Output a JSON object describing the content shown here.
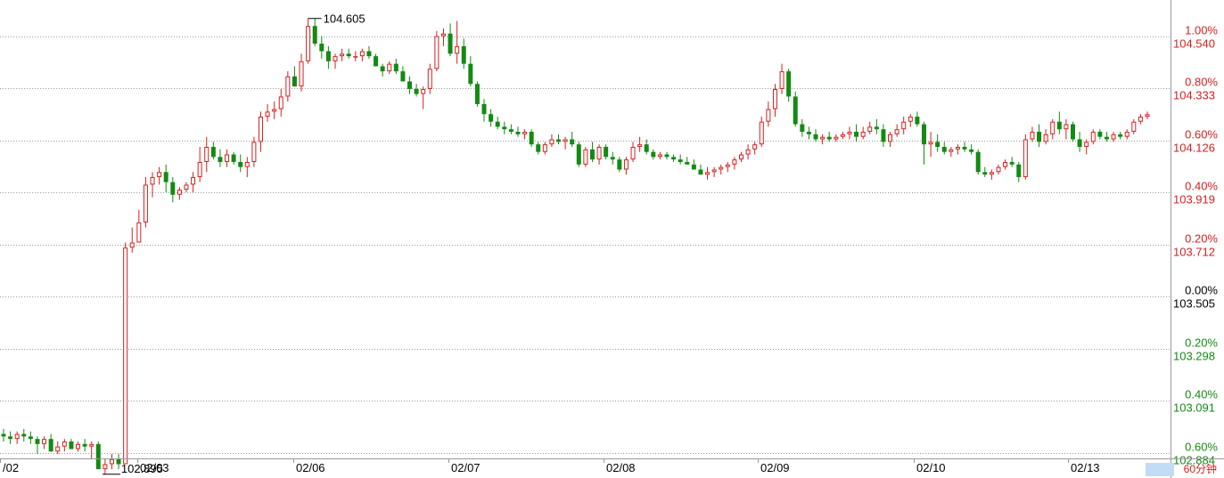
{
  "chart_data": {
    "type": "candlestick",
    "base_price": 103.505,
    "ylim": [
      102.884,
      104.655
    ],
    "grid": "dotted horizontal",
    "price_ticks": [
      "104.540",
      "104.333",
      "104.126",
      "103.919",
      "103.712",
      "103.505",
      "103.298",
      "103.091",
      "102.884"
    ],
    "pct_ticks": [
      "1.00%",
      "0.80%",
      "0.60%",
      "0.40%",
      "0.20%",
      "0.00%",
      "0.20%",
      "0.40%",
      "0.60%"
    ],
    "date_labels": [
      "/02",
      "02/03",
      "02/06",
      "02/07",
      "02/08",
      "02/09",
      "02/10",
      "02/13"
    ],
    "annotations": {
      "high_label": "104.605",
      "low_label": "102.895"
    },
    "candles": [
      [
        102.96,
        102.98,
        102.93,
        102.95
      ],
      [
        102.95,
        102.97,
        102.92,
        102.94
      ],
      [
        102.94,
        102.97,
        102.92,
        102.96
      ],
      [
        102.96,
        102.98,
        102.93,
        102.95
      ],
      [
        102.95,
        102.97,
        102.92,
        102.94
      ],
      [
        102.94,
        102.95,
        102.88,
        102.92
      ],
      [
        102.92,
        102.95,
        102.9,
        102.94
      ],
      [
        102.94,
        102.96,
        102.89,
        102.89
      ],
      [
        102.89,
        102.93,
        102.88,
        102.91
      ],
      [
        102.91,
        102.94,
        102.89,
        102.93
      ],
      [
        102.93,
        102.94,
        102.9,
        102.9
      ],
      [
        102.9,
        102.93,
        102.89,
        102.92
      ],
      [
        102.92,
        102.94,
        102.89,
        102.91
      ],
      [
        102.91,
        102.93,
        102.86,
        102.92
      ],
      [
        102.92,
        102.93,
        102.84,
        102.82
      ],
      [
        102.82,
        102.86,
        102.8,
        102.84
      ],
      [
        102.84,
        102.88,
        102.82,
        102.86
      ],
      [
        102.86,
        102.88,
        102.82,
        102.84
      ],
      [
        102.84,
        103.72,
        102.84,
        103.7
      ],
      [
        103.7,
        103.78,
        103.68,
        103.72
      ],
      [
        103.72,
        103.85,
        103.72,
        103.8
      ],
      [
        103.8,
        103.98,
        103.78,
        103.95
      ],
      [
        103.95,
        104.0,
        103.9,
        103.98
      ],
      [
        103.98,
        104.02,
        103.95,
        104.0
      ],
      [
        104.0,
        104.03,
        103.92,
        103.96
      ],
      [
        103.96,
        103.98,
        103.88,
        103.91
      ],
      [
        103.91,
        103.94,
        103.89,
        103.93
      ],
      [
        103.93,
        103.96,
        103.92,
        103.95
      ],
      [
        103.95,
        104.0,
        103.92,
        103.98
      ],
      [
        103.98,
        104.1,
        103.96,
        104.04
      ],
      [
        104.04,
        104.14,
        104.0,
        104.1
      ],
      [
        104.1,
        104.12,
        104.05,
        104.06
      ],
      [
        104.06,
        104.09,
        104.02,
        104.04
      ],
      [
        104.04,
        104.09,
        104.02,
        104.07
      ],
      [
        104.07,
        104.08,
        104.03,
        104.04
      ],
      [
        104.04,
        104.07,
        104.0,
        104.02
      ],
      [
        104.02,
        104.06,
        103.98,
        104.04
      ],
      [
        104.04,
        104.14,
        104.02,
        104.12
      ],
      [
        104.12,
        104.24,
        104.08,
        104.22
      ],
      [
        104.22,
        104.27,
        104.2,
        104.24
      ],
      [
        104.24,
        104.28,
        104.21,
        104.25
      ],
      [
        104.25,
        104.33,
        104.22,
        104.3
      ],
      [
        104.3,
        104.4,
        104.28,
        104.38
      ],
      [
        104.38,
        104.42,
        104.34,
        104.34
      ],
      [
        104.34,
        104.47,
        104.32,
        104.44
      ],
      [
        104.44,
        104.61,
        104.43,
        104.58
      ],
      [
        104.58,
        104.61,
        104.5,
        104.51
      ],
      [
        104.51,
        104.54,
        104.45,
        104.48
      ],
      [
        104.48,
        104.5,
        104.41,
        104.44
      ],
      [
        104.44,
        104.47,
        104.41,
        104.46
      ],
      [
        104.46,
        104.49,
        104.44,
        104.47
      ],
      [
        104.47,
        104.49,
        104.45,
        104.46
      ],
      [
        104.46,
        104.48,
        104.44,
        104.46
      ],
      [
        104.46,
        104.49,
        104.44,
        104.48
      ],
      [
        104.48,
        104.5,
        104.45,
        104.46
      ],
      [
        104.46,
        104.47,
        104.42,
        104.42
      ],
      [
        104.42,
        104.43,
        104.38,
        104.4
      ],
      [
        104.4,
        104.44,
        104.39,
        104.43
      ],
      [
        104.43,
        104.45,
        104.39,
        104.4
      ],
      [
        104.4,
        104.42,
        104.36,
        104.36
      ],
      [
        104.36,
        104.38,
        104.31,
        104.33
      ],
      [
        104.33,
        104.35,
        104.3,
        104.31
      ],
      [
        104.31,
        104.34,
        104.25,
        104.33
      ],
      [
        104.33,
        104.43,
        104.31,
        104.41
      ],
      [
        104.41,
        104.56,
        104.4,
        104.54
      ],
      [
        104.54,
        104.57,
        104.5,
        104.55
      ],
      [
        104.55,
        104.59,
        104.46,
        104.47
      ],
      [
        104.47,
        104.6,
        104.43,
        104.5
      ],
      [
        104.5,
        104.53,
        104.41,
        104.43
      ],
      [
        104.43,
        104.46,
        104.34,
        104.35
      ],
      [
        104.35,
        104.36,
        104.26,
        104.27
      ],
      [
        104.27,
        104.29,
        104.2,
        104.23
      ],
      [
        104.23,
        104.25,
        104.18,
        104.2
      ],
      [
        104.2,
        104.22,
        104.17,
        104.18
      ],
      [
        104.18,
        104.2,
        104.15,
        104.17
      ],
      [
        104.17,
        104.19,
        104.15,
        104.16
      ],
      [
        104.16,
        104.18,
        104.14,
        104.15
      ],
      [
        104.15,
        104.17,
        104.13,
        104.16
      ],
      [
        104.16,
        104.17,
        104.1,
        104.11
      ],
      [
        104.11,
        104.12,
        104.07,
        104.08
      ],
      [
        104.08,
        104.12,
        104.07,
        104.11
      ],
      [
        104.11,
        104.15,
        104.1,
        104.13
      ],
      [
        104.13,
        104.15,
        104.11,
        104.12
      ],
      [
        104.12,
        104.14,
        104.09,
        104.13
      ],
      [
        104.13,
        104.16,
        104.1,
        104.11
      ],
      [
        104.11,
        104.12,
        104.02,
        104.03
      ],
      [
        104.03,
        104.1,
        104.02,
        104.09
      ],
      [
        104.09,
        104.12,
        104.04,
        104.05
      ],
      [
        104.05,
        104.11,
        104.03,
        104.1
      ],
      [
        104.1,
        104.11,
        104.05,
        104.06
      ],
      [
        104.06,
        104.08,
        104.03,
        104.05
      ],
      [
        104.05,
        104.06,
        104.0,
        104.01
      ],
      [
        104.01,
        104.06,
        103.99,
        104.05
      ],
      [
        104.05,
        104.12,
        104.04,
        104.1
      ],
      [
        104.1,
        104.14,
        104.08,
        104.11
      ],
      [
        104.11,
        104.13,
        104.07,
        104.08
      ],
      [
        104.08,
        104.09,
        104.05,
        104.06
      ],
      [
        104.06,
        104.08,
        104.05,
        104.07
      ],
      [
        104.07,
        104.08,
        104.05,
        104.06
      ],
      [
        104.06,
        104.07,
        104.04,
        104.05
      ],
      [
        104.05,
        104.07,
        104.03,
        104.04
      ],
      [
        104.04,
        104.06,
        104.03,
        104.03
      ],
      [
        104.03,
        104.05,
        104.02,
        104.01
      ],
      [
        104.01,
        104.03,
        103.99,
        103.99
      ],
      [
        103.99,
        104.02,
        103.97,
        104.0
      ],
      [
        104.0,
        104.02,
        103.98,
        104.01
      ],
      [
        104.01,
        104.03,
        103.99,
        104.02
      ],
      [
        104.02,
        104.04,
        104.0,
        104.03
      ],
      [
        104.03,
        104.06,
        104.01,
        104.05
      ],
      [
        104.05,
        104.08,
        104.04,
        104.07
      ],
      [
        104.07,
        104.11,
        104.05,
        104.09
      ],
      [
        104.09,
        104.12,
        104.07,
        104.11
      ],
      [
        104.11,
        104.22,
        104.1,
        104.2
      ],
      [
        104.2,
        104.28,
        104.18,
        104.25
      ],
      [
        104.25,
        104.35,
        104.22,
        104.33
      ],
      [
        104.33,
        104.43,
        104.31,
        104.4
      ],
      [
        104.4,
        104.41,
        104.28,
        104.3
      ],
      [
        104.3,
        104.32,
        104.18,
        104.19
      ],
      [
        104.19,
        104.21,
        104.14,
        104.16
      ],
      [
        104.16,
        104.18,
        104.13,
        104.15
      ],
      [
        104.15,
        104.17,
        104.12,
        104.13
      ],
      [
        104.13,
        104.15,
        104.11,
        104.14
      ],
      [
        104.14,
        104.16,
        104.12,
        104.13
      ],
      [
        104.13,
        104.15,
        104.12,
        104.14
      ],
      [
        104.14,
        104.16,
        104.13,
        104.15
      ],
      [
        104.15,
        104.18,
        104.13,
        104.16
      ],
      [
        104.16,
        104.19,
        104.12,
        104.14
      ],
      [
        104.14,
        104.18,
        104.13,
        104.16
      ],
      [
        104.16,
        104.2,
        104.15,
        104.18
      ],
      [
        104.18,
        104.21,
        104.15,
        104.17
      ],
      [
        104.17,
        104.19,
        104.1,
        104.12
      ],
      [
        104.12,
        104.16,
        104.1,
        104.15
      ],
      [
        104.15,
        104.19,
        104.14,
        104.17
      ],
      [
        104.17,
        104.22,
        104.15,
        104.2
      ],
      [
        104.2,
        104.23,
        104.18,
        104.22
      ],
      [
        104.22,
        104.24,
        104.18,
        104.19
      ],
      [
        104.19,
        104.2,
        104.03,
        104.11
      ],
      [
        104.11,
        104.16,
        104.06,
        104.12
      ],
      [
        104.12,
        104.15,
        104.08,
        104.1
      ],
      [
        104.1,
        104.12,
        104.07,
        104.08
      ],
      [
        104.08,
        104.1,
        104.06,
        104.09
      ],
      [
        104.09,
        104.11,
        104.07,
        104.1
      ],
      [
        104.1,
        104.12,
        104.08,
        104.09
      ],
      [
        104.09,
        104.11,
        104.07,
        104.08
      ],
      [
        104.08,
        104.09,
        103.99,
        104.0
      ],
      [
        104.0,
        104.02,
        103.98,
        103.99
      ],
      [
        103.99,
        104.01,
        103.97,
        104.0
      ],
      [
        104.0,
        104.03,
        103.99,
        104.02
      ],
      [
        104.02,
        104.05,
        104.01,
        104.04
      ],
      [
        104.04,
        104.06,
        104.02,
        104.03
      ],
      [
        104.03,
        104.04,
        103.96,
        103.98
      ],
      [
        103.98,
        104.15,
        103.97,
        104.13
      ],
      [
        104.13,
        104.18,
        104.12,
        104.16
      ],
      [
        104.16,
        104.19,
        104.1,
        104.12
      ],
      [
        104.12,
        104.17,
        104.11,
        104.15
      ],
      [
        104.15,
        104.21,
        104.13,
        104.2
      ],
      [
        104.2,
        104.24,
        104.15,
        104.17
      ],
      [
        104.17,
        104.21,
        104.13,
        104.19
      ],
      [
        104.19,
        104.2,
        104.12,
        104.13
      ],
      [
        104.13,
        104.16,
        104.08,
        104.1
      ],
      [
        104.1,
        104.13,
        104.07,
        104.12
      ],
      [
        104.12,
        104.17,
        104.11,
        104.16
      ],
      [
        104.16,
        104.17,
        104.13,
        104.14
      ],
      [
        104.14,
        104.16,
        104.12,
        104.13
      ],
      [
        104.13,
        104.16,
        104.12,
        104.15
      ],
      [
        104.15,
        104.16,
        104.13,
        104.14
      ],
      [
        104.14,
        104.17,
        104.13,
        104.16
      ],
      [
        104.16,
        104.21,
        104.15,
        104.2
      ],
      [
        104.2,
        104.23,
        104.19,
        104.22
      ],
      [
        104.22,
        104.24,
        104.21,
        104.23
      ]
    ]
  },
  "ui": {
    "timeframe_label": "60分钟",
    "colors": {
      "up": "#d62020",
      "down": "#138a13",
      "pos_text": "#d62020",
      "neg_text": "#138a13",
      "grid": "#9a9a9a",
      "axis": "#999999",
      "text": "#000000",
      "badge_bg": "#c3dcf6"
    }
  }
}
